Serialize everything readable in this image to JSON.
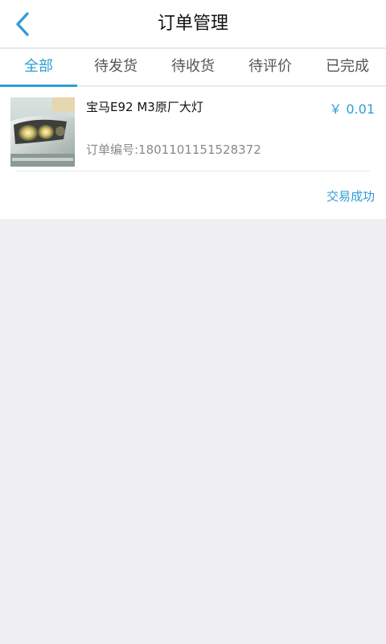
{
  "header": {
    "title": "订单管理",
    "back_icon": "chevron-left-icon"
  },
  "tabs": [
    {
      "label": "全部",
      "active": true
    },
    {
      "label": "待发货",
      "active": false
    },
    {
      "label": "待收货",
      "active": false
    },
    {
      "label": "待评价",
      "active": false
    },
    {
      "label": "已完成",
      "active": false
    }
  ],
  "order": {
    "product_name": "宝马E92 M3原厂大灯",
    "price": "￥ 0.01",
    "order_number": "订单编号:1801101151528372",
    "status": "交易成功"
  },
  "colors": {
    "accent": "#2f9ed6",
    "background": "#efeff4",
    "surface": "#ffffff"
  }
}
